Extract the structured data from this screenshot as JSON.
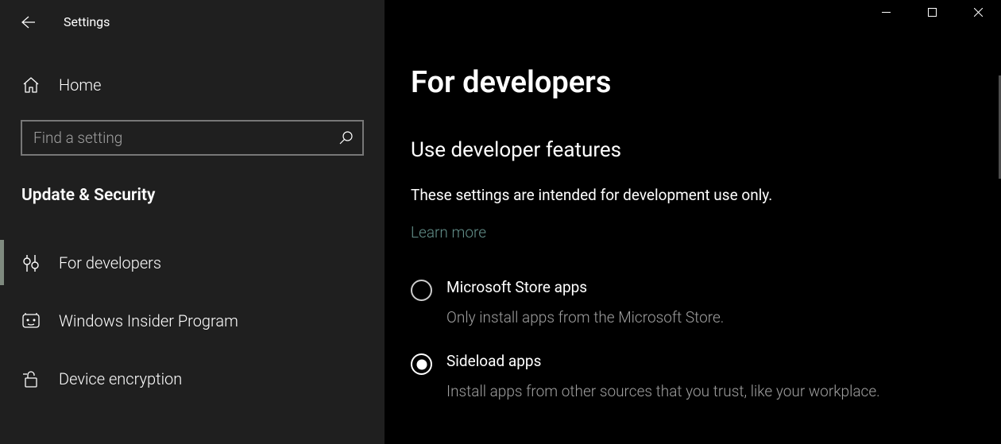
{
  "window": {
    "title": "Settings"
  },
  "sidebar": {
    "home_label": "Home",
    "search": {
      "placeholder": "Find a setting"
    },
    "section_title": "Update & Security",
    "items": [
      {
        "label": "For developers",
        "active": true
      },
      {
        "label": "Windows Insider Program",
        "active": false
      },
      {
        "label": "Device encryption",
        "active": false
      }
    ]
  },
  "content": {
    "heading": "For developers",
    "subheading": "Use developer features",
    "body": "These settings are intended for development use only.",
    "learn_more": "Learn more",
    "options": [
      {
        "label": "Microsoft Store apps",
        "desc": "Only install apps from the Microsoft Store.",
        "selected": false
      },
      {
        "label": "Sideload apps",
        "desc": "Install apps from other sources that you trust, like your workplace.",
        "selected": true
      }
    ]
  }
}
